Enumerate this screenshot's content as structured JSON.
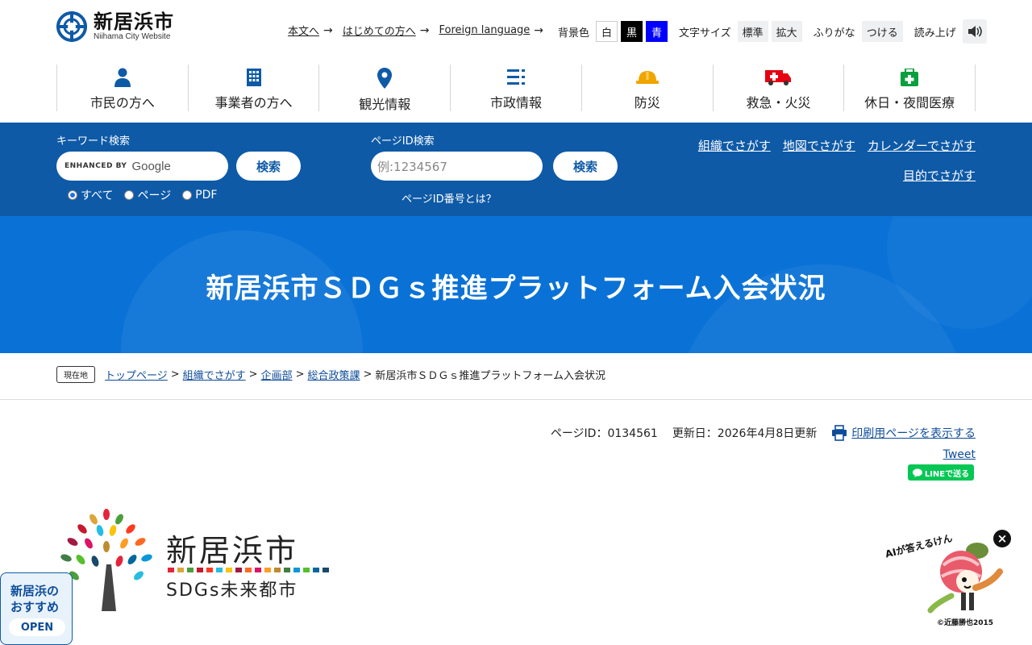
{
  "header": {
    "site_title": "新居浜市",
    "site_subtitle": "Niihama City Website",
    "links": [
      {
        "label": "本文へ"
      },
      {
        "label": "はじめての方へ"
      },
      {
        "label": "Foreign language"
      }
    ],
    "link_arrow": "→",
    "bg_color_label": "背景色",
    "bg_colors": {
      "white": "白",
      "black": "黒",
      "blue": "青"
    },
    "font_size_label": "文字サイズ",
    "font_size_standard": "標準",
    "font_size_large": "拡大",
    "furigana_label": "ふりがな",
    "furigana_button": "つける",
    "read_aloud_label": "読み上げ"
  },
  "nav": [
    {
      "label": "市民の方へ",
      "icon": "person-icon"
    },
    {
      "label": "事業者の方へ",
      "icon": "building-icon"
    },
    {
      "label": "観光情報",
      "icon": "map-pin-icon"
    },
    {
      "label": "市政情報",
      "icon": "list-icon"
    },
    {
      "label": "防災",
      "icon": "helmet-icon"
    },
    {
      "label": "救急・火災",
      "icon": "ambulance-icon"
    },
    {
      "label": "休日・夜間医療",
      "icon": "first-aid-icon"
    }
  ],
  "search": {
    "keyword_label": "キーワード検索",
    "google_enhanced": "ENHANCED BY",
    "google_brand": "Google",
    "search_button": "検索",
    "radios": [
      {
        "label": "すべて",
        "checked": true
      },
      {
        "label": "ページ",
        "checked": false
      },
      {
        "label": "PDF",
        "checked": false
      }
    ],
    "page_id_label": "ページID検索",
    "page_id_placeholder": "例:1234567",
    "page_id_button": "検索",
    "page_id_help": "ページID番号とは？",
    "find_links": [
      "組織でさがす",
      "地図でさがす",
      "カレンダーでさがす",
      "目的でさがす"
    ]
  },
  "page": {
    "title": "新居浜市ＳＤＧｓ推進プラットフォーム入会状況"
  },
  "breadcrumb": {
    "here_label": "現在地",
    "items": [
      "トップページ",
      "組織でさがす",
      "企画部",
      "総合政策課"
    ],
    "current": "新居浜市ＳＤＧｓ推進プラットフォーム入会状況",
    "separator": ">"
  },
  "page_info": {
    "page_id": "ページID：0134561",
    "updated": "更新日：2026年4月8日更新",
    "print_link": "印刷用ページを表示する",
    "tweet": "Tweet",
    "line_button": "LINEで送る"
  },
  "sdgs_logo": {
    "title": "新居浜市",
    "subtitle": "SDGs未来都市"
  },
  "floating": {
    "recommend_title_1": "新居浜の",
    "recommend_title_2": "おすすめ",
    "recommend_open": "OPEN",
    "ai_text": "AIが答えるけん",
    "ai_copyright": "©近藤勝也2015",
    "ai_close": "×"
  },
  "colors": {
    "band_blue": "#0e5aa7",
    "banner_blue": "#0a72d6",
    "link_blue": "#0e4c9a",
    "line_green": "#06c755"
  }
}
